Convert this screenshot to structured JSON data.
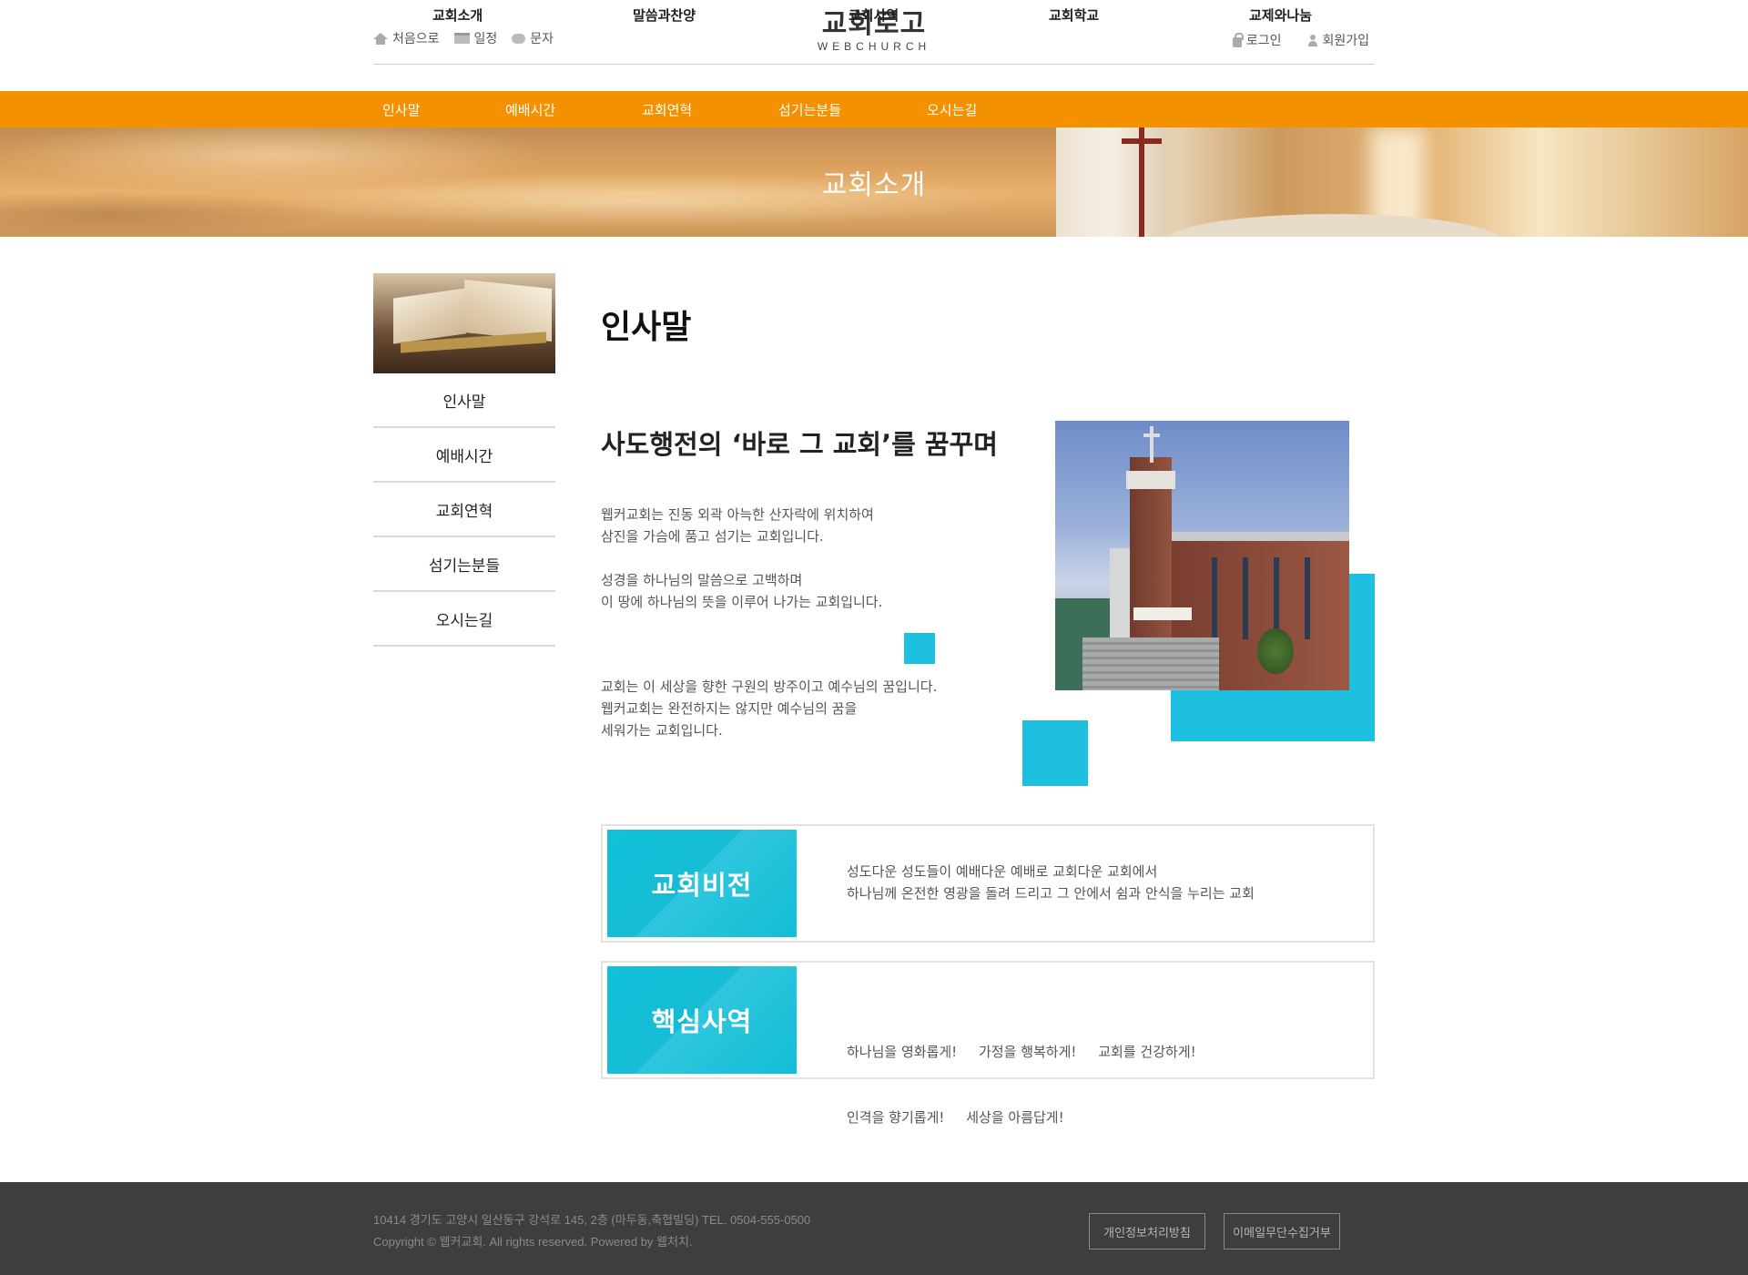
{
  "header": {
    "util_left": [
      {
        "label": "처음으로",
        "icon": "home-icon"
      },
      {
        "label": "일정",
        "icon": "calendar-icon"
      },
      {
        "label": "문자",
        "icon": "chat-icon"
      }
    ],
    "logo_main": "교회로고",
    "logo_sub": "WEBCHURCH",
    "util_right": [
      {
        "label": "로그인",
        "icon": "lock-icon"
      },
      {
        "label": "회원가입",
        "icon": "user-icon"
      }
    ]
  },
  "main_nav": [
    "교회소개",
    "말씀과찬양",
    "교회사역",
    "교회학교",
    "교제와나눔"
  ],
  "sub_nav": [
    "인사말",
    "예배시간",
    "교회연혁",
    "섬기는분들",
    "오시는길"
  ],
  "banner": {
    "title": "교회소개"
  },
  "sidebar": {
    "items": [
      "인사말",
      "예배시간",
      "교회연혁",
      "섬기는분들",
      "오시는길"
    ]
  },
  "content": {
    "page_title": "인사말",
    "headline_pre": "사도행전의 ",
    "headline_bold": "‘바로 그 교회’",
    "headline_post": "를 꿈꾸며",
    "paragraphs": [
      [
        "웹커교회는 진동 외곽 아늑한 산자락에 위치하여",
        "삼진을 가슴에 품고 섬기는 교회입니다."
      ],
      [
        "성경을 하나님의 말씀으로 고백하며",
        "이 땅에 하나님의 뜻을 이루어 나가는 교회입니다."
      ],
      [
        "교회는 이 세상을 향한 구원의 방주이고 예수님의 꿈입니다.",
        "웹커교회는 완전하지는 않지만 예수님의 꿈을",
        "세워가는 교회입니다."
      ]
    ],
    "vision": {
      "label": "교회비전",
      "lines": [
        "성도다운 성도들이 예배다운 예배로 교회다운 교회에서",
        "하나님께 온전한 영광을 돌려 드리고 그 안에서 쉼과 안식을 누리는 교회"
      ]
    },
    "core": {
      "label": "핵심사역",
      "lines": [
        "하나님을 영화롭게!     가정을 행복하게!     교회를 건강하게!",
        "인격을 향기롭게!     세상을 아름답게!"
      ]
    }
  },
  "footer": {
    "address": "10414 경기도 고양시 일산동구 강석로 145, 2층 (마두동,축협빌딩) TEL. 0504-555-0500",
    "copyright": "Copyright © 웹커교회. All rights reserved. Powered by 웹처치.",
    "buttons": [
      "개인정보처리방침",
      "이메일무단수집거부"
    ]
  },
  "colors": {
    "accent_orange": "#f39100",
    "accent_cyan": "#1ec0e0",
    "footer_bg": "#3e3e3e"
  }
}
